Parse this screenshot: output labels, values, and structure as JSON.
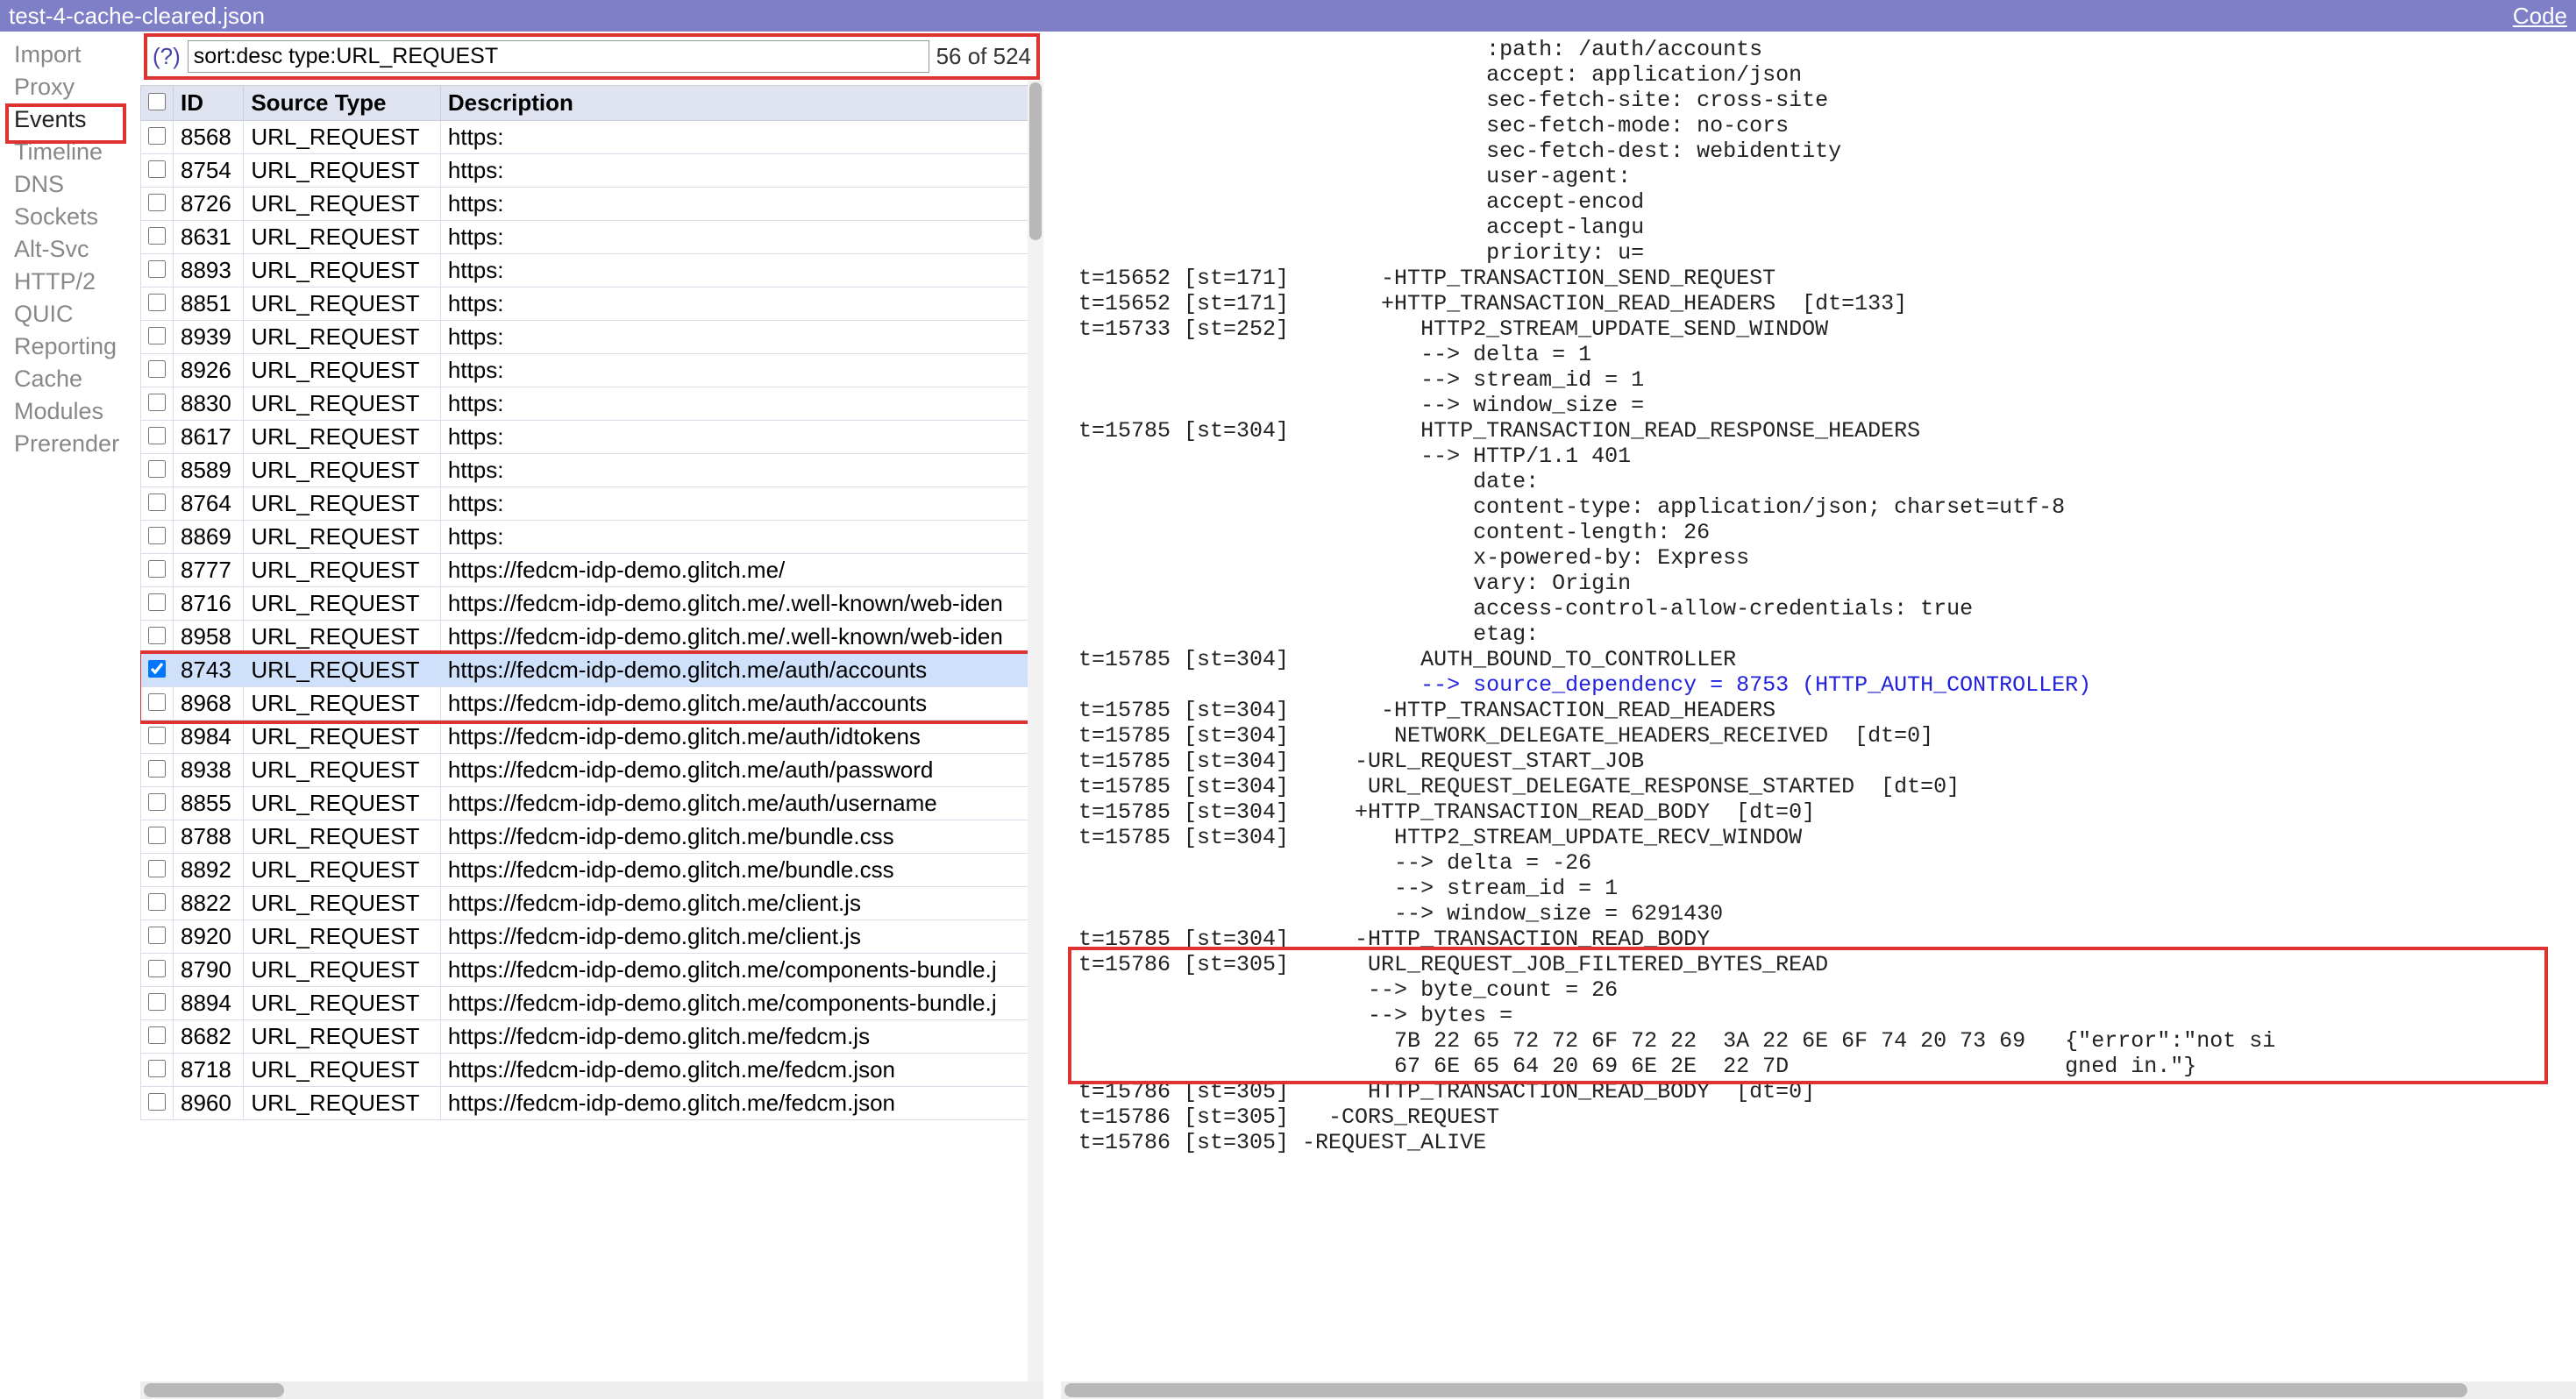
{
  "titlebar": {
    "filename": "test-4-cache-cleared.json",
    "code_link": "Code"
  },
  "sidebar": {
    "items": [
      "Import",
      "Proxy",
      "Events",
      "Timeline",
      "DNS",
      "Sockets",
      "Alt-Svc",
      "HTTP/2",
      "QUIC",
      "Reporting",
      "Cache",
      "Modules",
      "Prerender"
    ],
    "active_index": 2
  },
  "filter": {
    "help": "(?)",
    "query": "sort:desc type:URL_REQUEST",
    "count": "56 of 524"
  },
  "table": {
    "headers": [
      "",
      "ID",
      "Source Type",
      "Description"
    ],
    "rows": [
      {
        "checked": false,
        "id": "8568",
        "type": "URL_REQUEST",
        "desc": "https:"
      },
      {
        "checked": false,
        "id": "8754",
        "type": "URL_REQUEST",
        "desc": "https:"
      },
      {
        "checked": false,
        "id": "8726",
        "type": "URL_REQUEST",
        "desc": "https:"
      },
      {
        "checked": false,
        "id": "8631",
        "type": "URL_REQUEST",
        "desc": "https:"
      },
      {
        "checked": false,
        "id": "8893",
        "type": "URL_REQUEST",
        "desc": "https:"
      },
      {
        "checked": false,
        "id": "8851",
        "type": "URL_REQUEST",
        "desc": "https:"
      },
      {
        "checked": false,
        "id": "8939",
        "type": "URL_REQUEST",
        "desc": "https:"
      },
      {
        "checked": false,
        "id": "8926",
        "type": "URL_REQUEST",
        "desc": "https:"
      },
      {
        "checked": false,
        "id": "8830",
        "type": "URL_REQUEST",
        "desc": "https:"
      },
      {
        "checked": false,
        "id": "8617",
        "type": "URL_REQUEST",
        "desc": "https:"
      },
      {
        "checked": false,
        "id": "8589",
        "type": "URL_REQUEST",
        "desc": "https:"
      },
      {
        "checked": false,
        "id": "8764",
        "type": "URL_REQUEST",
        "desc": "https:"
      },
      {
        "checked": false,
        "id": "8869",
        "type": "URL_REQUEST",
        "desc": "https:"
      },
      {
        "checked": false,
        "id": "8777",
        "type": "URL_REQUEST",
        "desc": "https://fedcm-idp-demo.glitch.me/"
      },
      {
        "checked": false,
        "id": "8716",
        "type": "URL_REQUEST",
        "desc": "https://fedcm-idp-demo.glitch.me/.well-known/web-iden"
      },
      {
        "checked": false,
        "id": "8958",
        "type": "URL_REQUEST",
        "desc": "https://fedcm-idp-demo.glitch.me/.well-known/web-iden"
      },
      {
        "checked": true,
        "id": "8743",
        "type": "URL_REQUEST",
        "desc": "https://fedcm-idp-demo.glitch.me/auth/accounts",
        "selected": true
      },
      {
        "checked": false,
        "id": "8968",
        "type": "URL_REQUEST",
        "desc": "https://fedcm-idp-demo.glitch.me/auth/accounts"
      },
      {
        "checked": false,
        "id": "8984",
        "type": "URL_REQUEST",
        "desc": "https://fedcm-idp-demo.glitch.me/auth/idtokens"
      },
      {
        "checked": false,
        "id": "8938",
        "type": "URL_REQUEST",
        "desc": "https://fedcm-idp-demo.glitch.me/auth/password"
      },
      {
        "checked": false,
        "id": "8855",
        "type": "URL_REQUEST",
        "desc": "https://fedcm-idp-demo.glitch.me/auth/username"
      },
      {
        "checked": false,
        "id": "8788",
        "type": "URL_REQUEST",
        "desc": "https://fedcm-idp-demo.glitch.me/bundle.css"
      },
      {
        "checked": false,
        "id": "8892",
        "type": "URL_REQUEST",
        "desc": "https://fedcm-idp-demo.glitch.me/bundle.css"
      },
      {
        "checked": false,
        "id": "8822",
        "type": "URL_REQUEST",
        "desc": "https://fedcm-idp-demo.glitch.me/client.js"
      },
      {
        "checked": false,
        "id": "8920",
        "type": "URL_REQUEST",
        "desc": "https://fedcm-idp-demo.glitch.me/client.js"
      },
      {
        "checked": false,
        "id": "8790",
        "type": "URL_REQUEST",
        "desc": "https://fedcm-idp-demo.glitch.me/components-bundle.j"
      },
      {
        "checked": false,
        "id": "8894",
        "type": "URL_REQUEST",
        "desc": "https://fedcm-idp-demo.glitch.me/components-bundle.j"
      },
      {
        "checked": false,
        "id": "8682",
        "type": "URL_REQUEST",
        "desc": "https://fedcm-idp-demo.glitch.me/fedcm.js"
      },
      {
        "checked": false,
        "id": "8718",
        "type": "URL_REQUEST",
        "desc": "https://fedcm-idp-demo.glitch.me/fedcm.json"
      },
      {
        "checked": false,
        "id": "8960",
        "type": "URL_REQUEST",
        "desc": "https://fedcm-idp-demo.glitch.me/fedcm.json"
      }
    ]
  },
  "log": {
    "lines": [
      "                               :path: /auth/accounts",
      "                               accept: application/json",
      "                               sec-fetch-site: cross-site",
      "                               sec-fetch-mode: no-cors",
      "                               sec-fetch-dest: webidentity",
      "                               user-agent:",
      "                               accept-encod",
      "                               accept-langu",
      "                               priority: u=",
      "t=15652 [st=171]       -HTTP_TRANSACTION_SEND_REQUEST",
      "t=15652 [st=171]       +HTTP_TRANSACTION_READ_HEADERS  [dt=133]",
      "t=15733 [st=252]          HTTP2_STREAM_UPDATE_SEND_WINDOW",
      "                          --> delta = 1",
      "                          --> stream_id = 1",
      "                          --> window_size =",
      "t=15785 [st=304]          HTTP_TRANSACTION_READ_RESPONSE_HEADERS",
      "                          --> HTTP/1.1 401",
      "                              date:",
      "                              content-type: application/json; charset=utf-8",
      "                              content-length: 26",
      "                              x-powered-by: Express",
      "                              vary: Origin",
      "                              access-control-allow-credentials: true",
      "                              etag:",
      "t=15785 [st=304]          AUTH_BOUND_TO_CONTROLLER"
    ],
    "dep_line": "                          --> source_dependency = 8753 (HTTP_AUTH_CONTROLLER)",
    "lines2": [
      "t=15785 [st=304]       -HTTP_TRANSACTION_READ_HEADERS",
      "t=15785 [st=304]        NETWORK_DELEGATE_HEADERS_RECEIVED  [dt=0]",
      "t=15785 [st=304]     -URL_REQUEST_START_JOB",
      "t=15785 [st=304]      URL_REQUEST_DELEGATE_RESPONSE_STARTED  [dt=0]",
      "t=15785 [st=304]     +HTTP_TRANSACTION_READ_BODY  [dt=0]",
      "t=15785 [st=304]        HTTP2_STREAM_UPDATE_RECV_WINDOW",
      "                        --> delta = -26",
      "                        --> stream_id = 1",
      "                        --> window_size = 6291430",
      "t=15785 [st=304]     -HTTP_TRANSACTION_READ_BODY",
      "t=15786 [st=305]      URL_REQUEST_JOB_FILTERED_BYTES_READ",
      "                      --> byte_count = 26",
      "                      --> bytes =",
      "                        7B 22 65 72 72 6F 72 22  3A 22 6E 6F 74 20 73 69   {\"error\":\"not si",
      "                        67 6E 65 64 20 69 6E 2E  22 7D                     gned in.\"}",
      "t=15786 [st=305]      HTTP_TRANSACTION_READ_BODY  [dt=0]",
      "t=15786 [st=305]   -CORS_REQUEST",
      "t=15786 [st=305] -REQUEST_ALIVE"
    ]
  }
}
